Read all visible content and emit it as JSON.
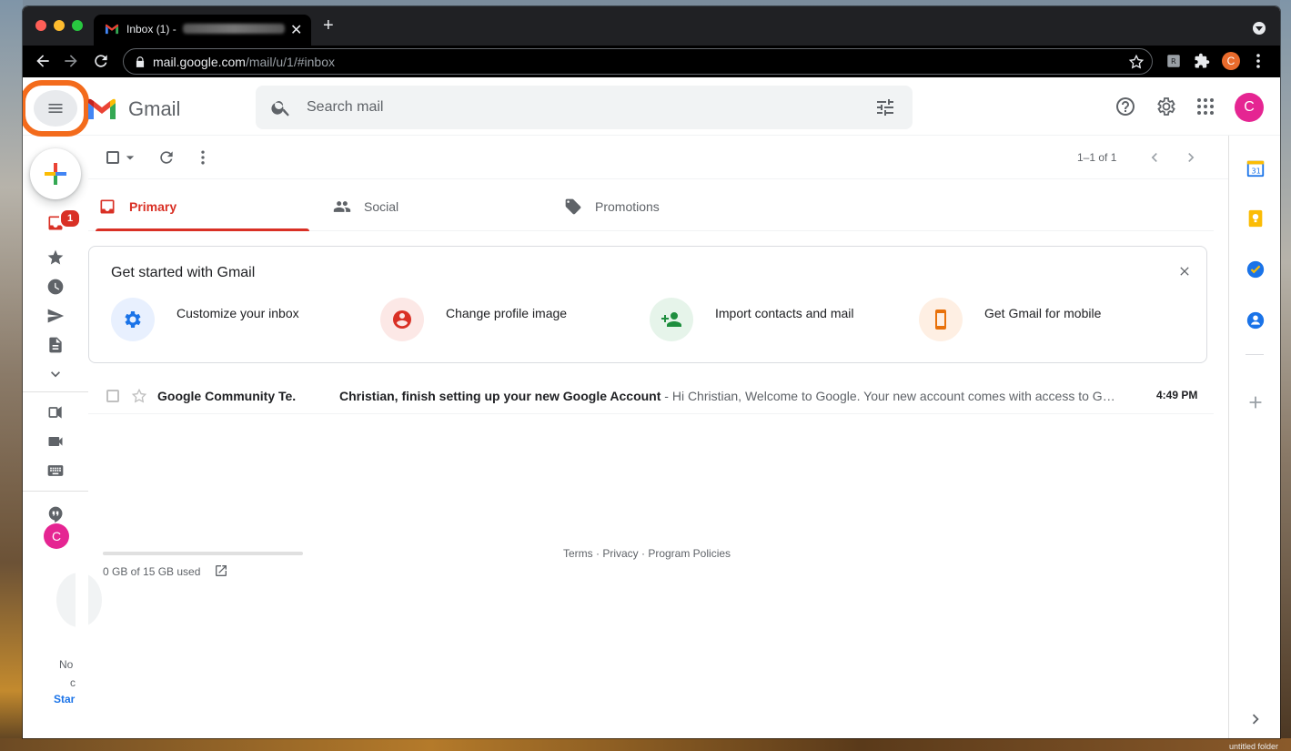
{
  "browser": {
    "tab_title": "Inbox (1) -",
    "url_host": "mail.google.com",
    "url_path": "/mail/u/1/#inbox",
    "profile_initial": "C"
  },
  "gmail": {
    "logo_text": "Gmail",
    "search_placeholder": "Search mail",
    "user_initial": "C",
    "inbox_unread": "1",
    "pager": "1–1 of 1",
    "tabs": [
      {
        "label": "Primary"
      },
      {
        "label": "Social"
      },
      {
        "label": "Promotions"
      }
    ],
    "get_started": {
      "title": "Get started with Gmail",
      "items": [
        {
          "label": "Customize your inbox",
          "icon": "gear-icon",
          "color": "#1a73e8",
          "bg": "#e8f0fe"
        },
        {
          "label": "Change profile image",
          "icon": "account-circle-icon",
          "color": "#d93025",
          "bg": "#fce8e6"
        },
        {
          "label": "Import contacts and mail",
          "icon": "add-person-icon",
          "color": "#1e8e3e",
          "bg": "#e6f4ea"
        },
        {
          "label": "Get Gmail for mobile",
          "icon": "phone-icon",
          "color": "#e8710a",
          "bg": "#feefe3"
        }
      ]
    },
    "emails": [
      {
        "sender": "Google Community Te.",
        "subject": "Christian, finish setting up your new Google Account",
        "snippet": " - Hi Christian, Welcome to Google. Your new account comes with access to Google products, apps, and services.",
        "time": "4:49 PM"
      }
    ],
    "storage": "0 GB of 15 GB used",
    "footer": "Terms · Privacy · Program Policies",
    "leftnav": {
      "partial_text_1": "No",
      "partial_text_2": "c",
      "partial_link": "Star"
    }
  },
  "desktop": {
    "folder_label": "untitled folder"
  },
  "colors": {
    "accent_red": "#d93025",
    "highlight_ring": "#f36b1c",
    "avatar": "#e52592"
  }
}
